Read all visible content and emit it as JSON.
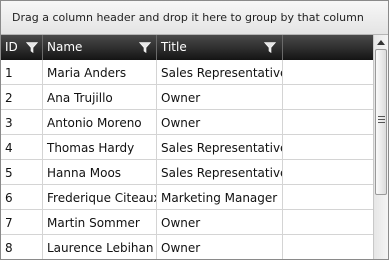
{
  "group_panel": {
    "text": "Drag a column header and drop it here to group by that column"
  },
  "columns": [
    {
      "label": "ID"
    },
    {
      "label": "Name"
    },
    {
      "label": "Title"
    },
    {
      "label": ""
    }
  ],
  "rows": [
    {
      "id": "1",
      "name": "Maria Anders",
      "title": "Sales Representative"
    },
    {
      "id": "2",
      "name": "Ana Trujillo",
      "title": "Owner"
    },
    {
      "id": "3",
      "name": "Antonio Moreno",
      "title": "Owner"
    },
    {
      "id": "4",
      "name": "Thomas Hardy",
      "title": "Sales Representative"
    },
    {
      "id": "5",
      "name": "Hanna Moos",
      "title": "Sales Representative"
    },
    {
      "id": "6",
      "name": "Frederique Citeaux",
      "title": "Marketing Manager"
    },
    {
      "id": "7",
      "name": "Martin Sommer",
      "title": "Owner"
    },
    {
      "id": "8",
      "name": "Laurence Lebihan",
      "title": "Owner"
    }
  ],
  "icons": {
    "filter": "funnel-icon",
    "scroll_up": "arrow-up-icon"
  },
  "colors": {
    "header_bg": "#2d2d2d",
    "header_text": "#ffffff",
    "grid_line": "#d4d4d4"
  }
}
